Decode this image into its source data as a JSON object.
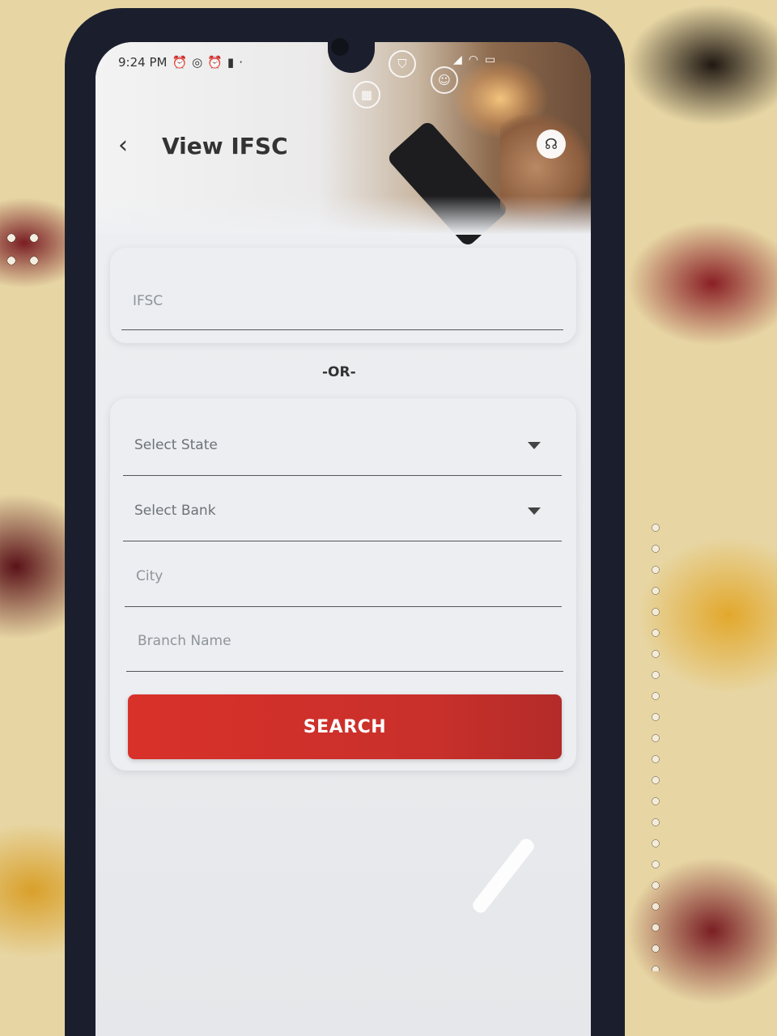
{
  "status_bar": {
    "time": "9:24 PM",
    "left_icons": [
      "alarm-icon",
      "whatsapp-icon",
      "alarm-icon",
      "lock-icon"
    ],
    "right_icons": [
      "signal-icon",
      "wifi-icon",
      "battery-icon"
    ]
  },
  "header": {
    "title": "View IFSC",
    "back_glyph": "‹",
    "support_glyph": "☊"
  },
  "form": {
    "ifsc_placeholder": "IFSC",
    "or_separator": "-OR-",
    "state_placeholder": "Select State",
    "bank_placeholder": "Select Bank",
    "city_placeholder": "City",
    "branch_placeholder": "Branch Name",
    "search_label": "SEARCH"
  },
  "colors": {
    "accent": "#d8312a",
    "text": "#333333",
    "placeholder": "#8f9499"
  }
}
